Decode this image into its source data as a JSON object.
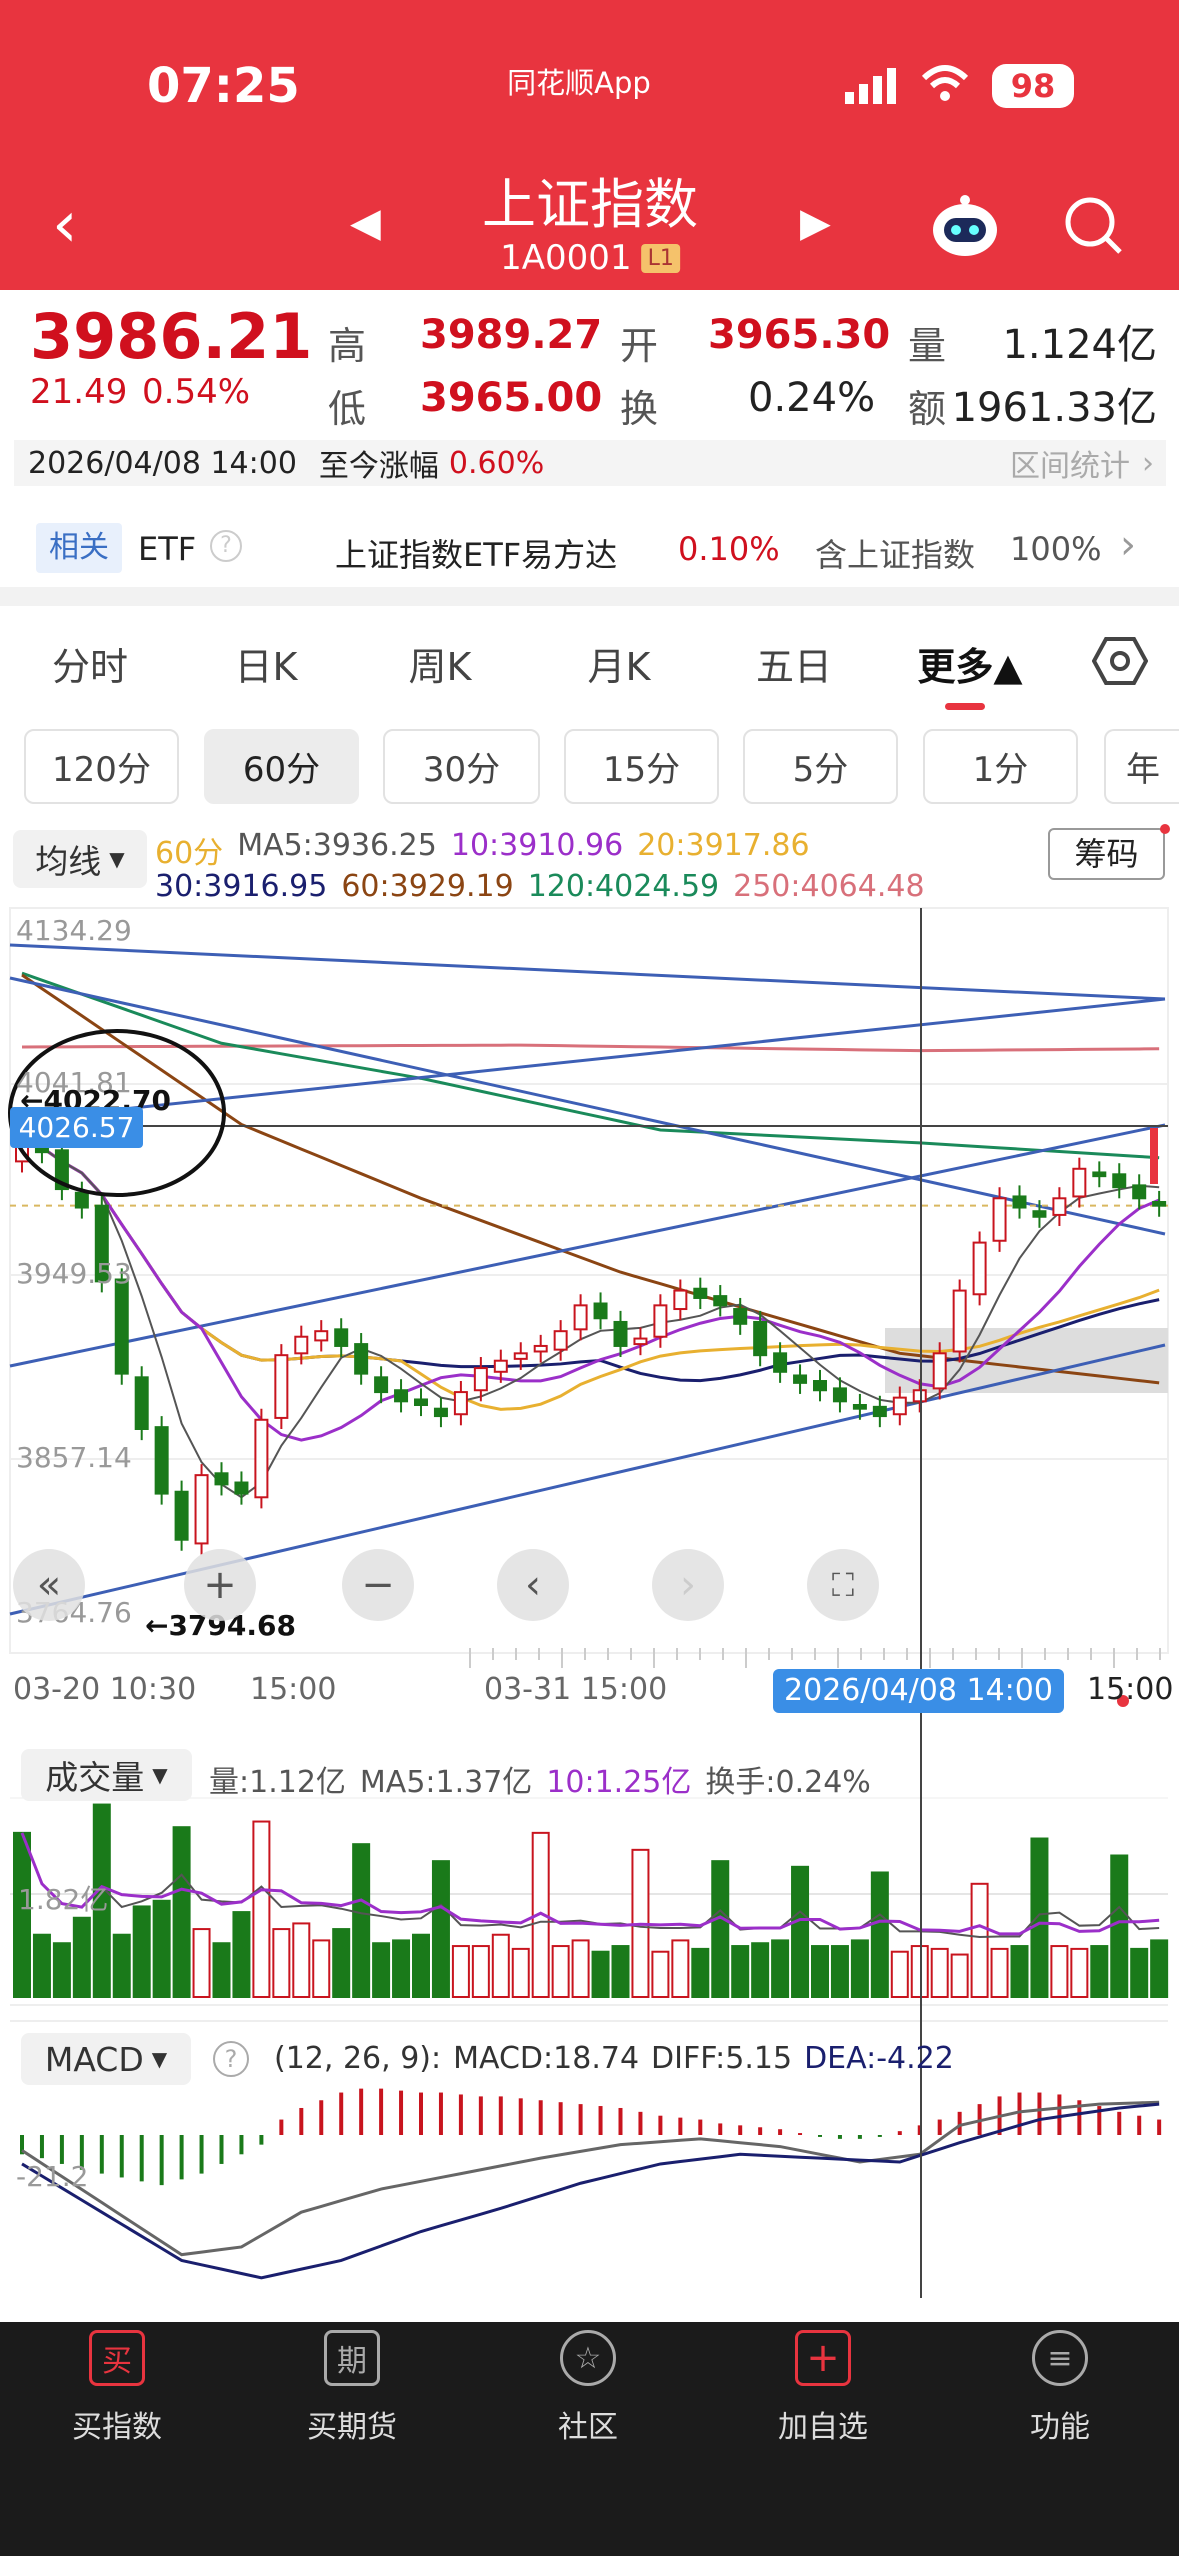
{
  "status": {
    "time": "07:25",
    "app": "同花顺App",
    "battery": "98"
  },
  "header": {
    "title": "上证指数",
    "code": "1A0001",
    "level": "L1"
  },
  "quote": {
    "price": "3986.21",
    "change": "21.49",
    "change_pct": "0.54%",
    "high_label": "高",
    "high": "3989.27",
    "open_label": "开",
    "open": "3965.30",
    "vol_label": "量",
    "vol": "1.124亿",
    "low_label": "低",
    "low": "3965.00",
    "turn_label": "换",
    "turn": "0.24%",
    "amt_label": "额",
    "amt": "1961.33亿"
  },
  "range": {
    "datetime": "2026/04/08 14:00",
    "label": "至今涨幅",
    "value": "0.60%",
    "stats": "区间统计"
  },
  "etf": {
    "badge": "相关",
    "label": "ETF",
    "name": "上证指数ETF易方达",
    "pct": "0.10%",
    "contains": "含上证指数",
    "weight": "100%"
  },
  "tabs": [
    "分时",
    "日K",
    "周K",
    "月K",
    "五日",
    "更多▲"
  ],
  "subtabs": [
    "120分",
    "60分",
    "30分",
    "15分",
    "5分",
    "1分",
    "年"
  ],
  "ma_legend": {
    "selector": "均线",
    "period": "60分",
    "ma5": "MA5:3936.25",
    "ma10": "10:3910.96",
    "ma20": "20:3917.86",
    "ma30": "30:3916.95",
    "ma60": "60:3929.19",
    "ma120": "120:4024.59",
    "ma250": "250:4064.48",
    "chips": "筹码"
  },
  "colors": {
    "up": "#c8141e",
    "down": "#1a7a1a",
    "ma5": "#555555",
    "ma10": "#9b2fc9",
    "ma20": "#e8b030",
    "ma30": "#1a1f6e",
    "ma60": "#8b4513",
    "ma120": "#1a8a5a",
    "ma250": "#d8707a",
    "accent": "#e8343f",
    "blue": "#3a8ee6"
  },
  "chart_data": {
    "type": "candlestick",
    "y_ticks": [
      "4134.29",
      "4041.81",
      "3949.53",
      "3857.14",
      "3764.76"
    ],
    "ylim": [
      3764.76,
      4134.29
    ],
    "cursor_price": "4026.57",
    "high_marker": "←4022.70",
    "low_marker": "←3794.68",
    "x_labels": [
      "03-20 10:30",
      "15:00",
      "03-31 15:00",
      "15:00"
    ],
    "cursor_time": "2026/04/08 14:00",
    "close": [
      4020,
      4015,
      3995,
      3985,
      3945,
      3895,
      3865,
      3830,
      3805,
      3840,
      3835,
      3830,
      3870,
      3905,
      3915,
      3918,
      3910,
      3895,
      3885,
      3880,
      3878,
      3872,
      3885,
      3898,
      3902,
      3906,
      3910,
      3918,
      3932,
      3925,
      3910,
      3914,
      3932,
      3940,
      3936,
      3932,
      3922,
      3905,
      3896,
      3890,
      3886,
      3880,
      3876,
      3872,
      3882,
      3886,
      3906,
      3940,
      3966,
      3990,
      3985,
      3980,
      3990,
      4006,
      4002,
      3996,
      3990,
      3986
    ],
    "ma60": [
      [
        0,
        4111
      ],
      [
        11,
        4030
      ],
      [
        20,
        3990
      ],
      [
        30,
        3950
      ],
      [
        44,
        3906
      ],
      [
        57,
        3890
      ]
    ],
    "ma120": [
      [
        0,
        4112
      ],
      [
        10,
        4074
      ],
      [
        20,
        4055
      ],
      [
        32,
        4027
      ],
      [
        45,
        4020
      ],
      [
        57,
        4012
      ]
    ],
    "ma250": [
      [
        0,
        4072
      ],
      [
        25,
        4073
      ],
      [
        45,
        4070
      ],
      [
        57,
        4071
      ]
    ],
    "volume": {
      "legend_selector": "成交量",
      "vol": "量:1.12亿",
      "ma5": "MA5:1.37亿",
      "ma10": "10:1.25亿",
      "turn": "换手:0.24%",
      "tick": "1.82亿",
      "values": [
        2.9,
        1.1,
        0.95,
        1.4,
        3.4,
        1.1,
        1.6,
        1.7,
        3.0,
        1.2,
        0.95,
        1.5,
        3.1,
        1.2,
        1.3,
        1.0,
        1.2,
        2.7,
        0.95,
        1.0,
        1.1,
        2.4,
        0.9,
        0.9,
        1.1,
        0.85,
        2.9,
        0.9,
        1.0,
        0.8,
        0.9,
        2.6,
        0.8,
        1.0,
        0.85,
        2.4,
        0.9,
        0.95,
        1.0,
        2.3,
        0.9,
        0.9,
        1.0,
        2.2,
        0.8,
        0.9,
        0.85,
        0.75,
        2.0,
        0.85,
        0.9,
        2.8,
        0.9,
        0.85,
        0.9,
        2.5,
        0.85,
        1.0
      ]
    },
    "macd": {
      "selector": "MACD",
      "params": "(12, 26, 9):",
      "macd": "MACD:18.74",
      "diff": "DIFF:5.15",
      "dea": "DEA:-4.22",
      "tick": "-21.2",
      "hist": [
        -10,
        -12,
        -15,
        -18,
        -20,
        -22,
        -24,
        -26,
        -23,
        -20,
        -15,
        -10,
        -5,
        8,
        14,
        18,
        22,
        24,
        24,
        23,
        22,
        22,
        21,
        20,
        20,
        19,
        18,
        17,
        16,
        15,
        14,
        12,
        10,
        9,
        8,
        6,
        5,
        4,
        3,
        1,
        -1,
        -2,
        -2,
        -1,
        2,
        5,
        8,
        12,
        16,
        20,
        22,
        22,
        21,
        18,
        15,
        12,
        10,
        8
      ],
      "diff_pts": [
        [
          0,
          -8
        ],
        [
          4,
          -35
        ],
        [
          8,
          -62
        ],
        [
          11,
          -58
        ],
        [
          14,
          -40
        ],
        [
          18,
          -28
        ],
        [
          22,
          -20
        ],
        [
          26,
          -12
        ],
        [
          30,
          -5
        ],
        [
          34,
          -2
        ],
        [
          38,
          -6
        ],
        [
          42,
          -14
        ],
        [
          45,
          -10
        ],
        [
          47,
          5
        ],
        [
          50,
          12
        ],
        [
          54,
          16
        ],
        [
          57,
          17
        ]
      ],
      "dea_pts": [
        [
          0,
          -15
        ],
        [
          4,
          -40
        ],
        [
          8,
          -65
        ],
        [
          12,
          -74
        ],
        [
          16,
          -65
        ],
        [
          20,
          -50
        ],
        [
          24,
          -38
        ],
        [
          28,
          -25
        ],
        [
          32,
          -15
        ],
        [
          36,
          -10
        ],
        [
          40,
          -12
        ],
        [
          44,
          -14
        ],
        [
          47,
          -4
        ],
        [
          51,
          8
        ],
        [
          55,
          14
        ],
        [
          57,
          16
        ]
      ]
    }
  },
  "bottom_nav": [
    {
      "icon": "买",
      "label": "买指数"
    },
    {
      "icon": "期",
      "label": "买期货"
    },
    {
      "icon": "☆",
      "label": "社区"
    },
    {
      "icon": "+",
      "label": "加自选"
    },
    {
      "icon": "≡",
      "label": "功能"
    }
  ]
}
